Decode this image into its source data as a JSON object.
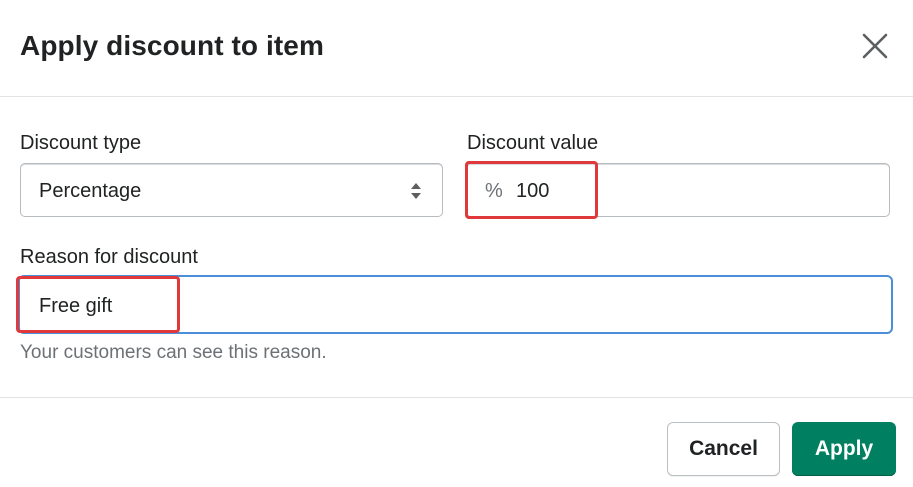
{
  "dialog": {
    "title": "Apply discount to item"
  },
  "discount_type": {
    "label": "Discount type",
    "selected": "Percentage"
  },
  "discount_value": {
    "label": "Discount value",
    "prefix": "%",
    "value": "100"
  },
  "reason": {
    "label": "Reason for discount",
    "value": "Free gift",
    "help_text": "Your customers can see this reason."
  },
  "footer": {
    "cancel_label": "Cancel",
    "apply_label": "Apply"
  },
  "icons": {
    "close": "close-icon",
    "select_arrows": "select-arrows-icon"
  },
  "colors": {
    "primary": "#008060",
    "focus": "#4c8fd9",
    "highlight": "#e0393c",
    "text": "#202223",
    "subdued": "#6d7175"
  }
}
